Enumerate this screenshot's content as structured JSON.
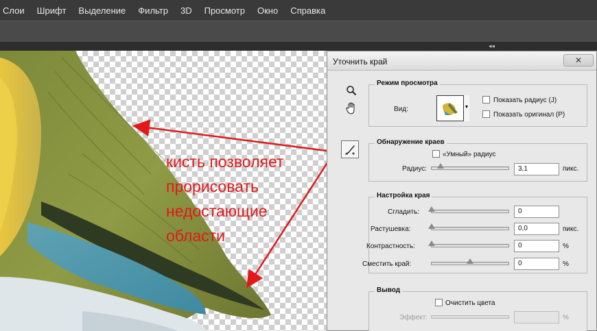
{
  "menubar": {
    "items": [
      "Слои",
      "Шрифт",
      "Выделение",
      "Фильтр",
      "3D",
      "Просмотр",
      "Окно",
      "Справка"
    ]
  },
  "annotation": {
    "lines": [
      "кисть позволяет",
      "прорисовать",
      "недостающие",
      "области"
    ],
    "color": "#e0191b"
  },
  "dialog": {
    "title": "Уточнить край",
    "close_icon": "close-icon",
    "tools": [
      "zoom-icon",
      "hand-icon",
      "refine-radius-brush-icon"
    ],
    "view_mode": {
      "legend": "Режим просмотра",
      "view_label": "Вид:",
      "show_radius": "Показать радиус (J)",
      "show_original": "Показать оригинал (P)"
    },
    "edge_detection": {
      "legend": "Обнаружение краев",
      "smart_radius": "«Умный» радиус",
      "radius_label": "Радиус:",
      "radius_value": "3,1",
      "radius_unit": "пикс.",
      "radius_slider": 0.12
    },
    "adjust_edge": {
      "legend": "Настройка края",
      "smooth_label": "Сгладить:",
      "smooth_value": "0",
      "feather_label": "Растушевка:",
      "feather_value": "0,0",
      "feather_unit": "пикс.",
      "contrast_label": "Контрастность:",
      "contrast_value": "0",
      "contrast_unit": "%",
      "shift_label": "Сместить край:",
      "shift_value": "0",
      "shift_unit": "%",
      "smooth_slider": 0,
      "feather_slider": 0,
      "contrast_slider": 0,
      "shift_slider": 0.5
    },
    "output": {
      "legend": "Вывод",
      "decontaminate": "Очистить цвета",
      "effect_label": "Эффект:",
      "effect_value": "",
      "effect_unit": "%"
    }
  }
}
